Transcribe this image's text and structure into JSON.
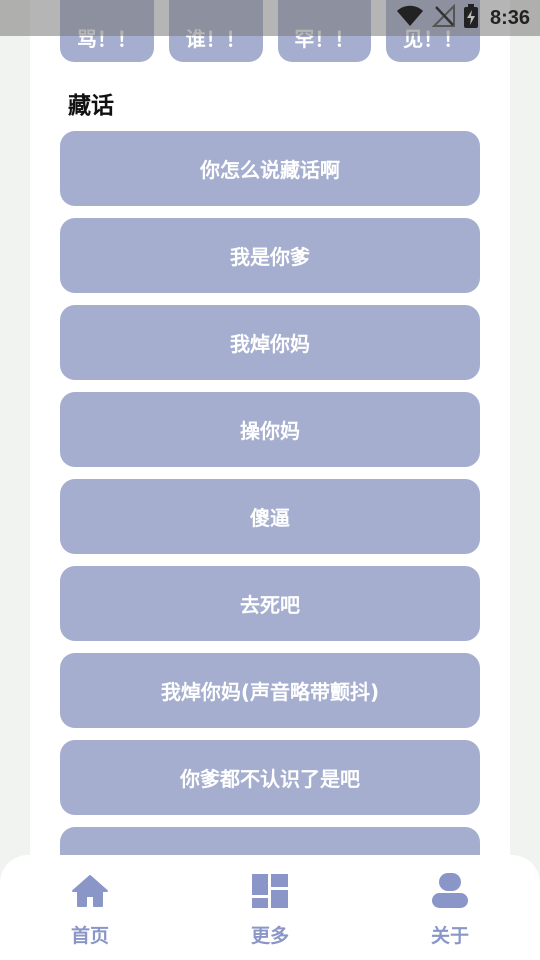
{
  "status_bar": {
    "time": "8:36",
    "icons": [
      "wifi-icon",
      "no-signal-icon",
      "battery-charging-icon"
    ]
  },
  "top_row": {
    "buttons": [
      "骂！！",
      "谁！！",
      "罕！！",
      "见！！"
    ]
  },
  "section": {
    "title": "藏话"
  },
  "phrases": [
    "你怎么说藏话啊",
    "我是你爹",
    "我焯你妈",
    "操你妈",
    "傻逼",
    "去死吧",
    "我焯你妈(声音略带颤抖)",
    "你爹都不认识了是吧",
    ""
  ],
  "bottom_nav": {
    "items": [
      {
        "label": "首页",
        "icon": "home-icon"
      },
      {
        "label": "更多",
        "icon": "dashboard-icon"
      },
      {
        "label": "关于",
        "icon": "person-icon"
      }
    ]
  },
  "colors": {
    "button": "#a5aecf",
    "nav_accent": "#8a96c8",
    "background": "#f1f3f0",
    "card": "#ffffff"
  }
}
